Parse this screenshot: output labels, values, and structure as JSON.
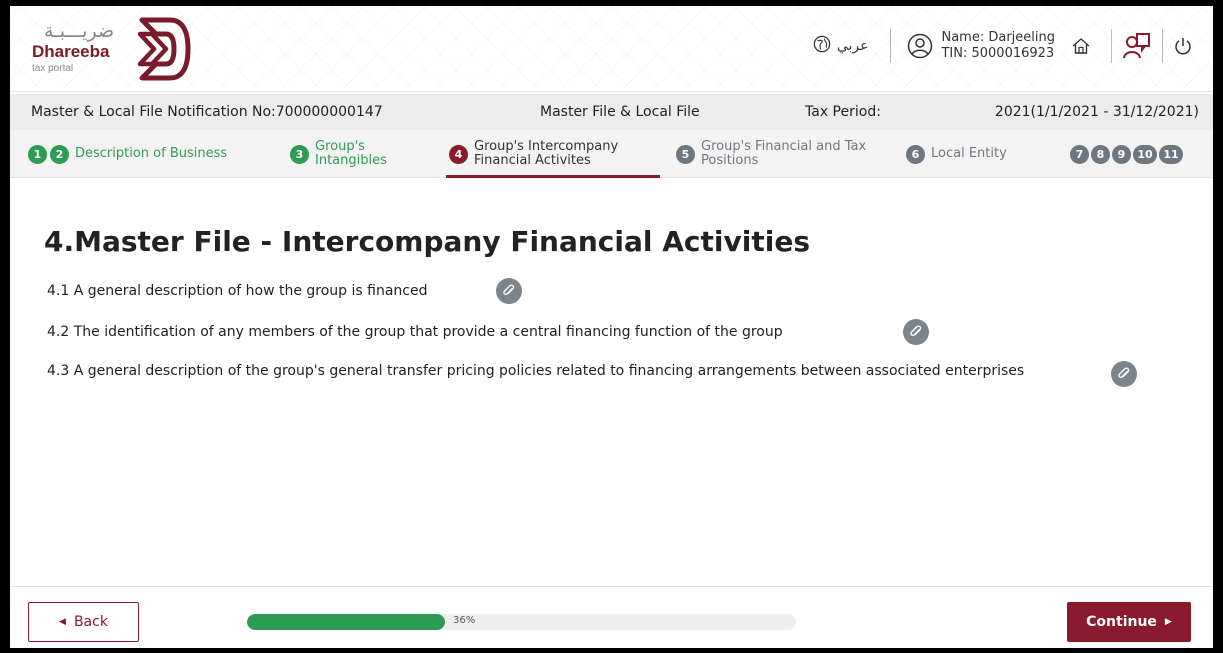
{
  "header": {
    "logo_arabic": "ضريـــبـة",
    "logo_name": "Dhareeba",
    "logo_sub": "tax portal",
    "language_label": "عربي",
    "user_name": "Name: Darjeeling",
    "user_tin": "TIN: 5000016923",
    "icons": [
      "globe-icon",
      "user-icon",
      "home-icon",
      "users-icon",
      "power-icon"
    ]
  },
  "infobar": {
    "notification": "Master & Local File Notification No:700000000147",
    "file_type": "Master File & Local File",
    "tax_period_label": "Tax Period:",
    "tax_period_value": "2021(1/1/2021 - 31/12/2021)"
  },
  "stepper": {
    "steps": [
      {
        "num": "1",
        "label": ""
      },
      {
        "num": "2",
        "label": "Description of Business"
      },
      {
        "num": "3",
        "label": "Group's Intangibles"
      },
      {
        "num": "4",
        "label": "Group's Intercompany Financial Activites"
      },
      {
        "num": "5",
        "label": "Group's Financial and Tax Positions"
      },
      {
        "num": "6",
        "label": "Local Entity"
      },
      {
        "num": "7",
        "label": ""
      },
      {
        "num": "8",
        "label": ""
      },
      {
        "num": "9",
        "label": ""
      },
      {
        "num": "10",
        "label": ""
      },
      {
        "num": "11",
        "label": ""
      }
    ]
  },
  "main": {
    "title": "4.Master File - Intercompany Financial Activities",
    "questions": [
      "4.1 A general description of how the group is financed",
      "4.2 The identification of any members of the group that provide a central financing function of the group",
      "4.3 A general description of the group's general transfer pricing policies related to financing arrangements between associated enterprises"
    ]
  },
  "footer": {
    "back_label": "Back",
    "continue_label": "Continue",
    "progress_text": "36%",
    "progress_fraction": 0.36
  },
  "colors": {
    "brand": "#8a1a2c",
    "green": "#2e9b53",
    "gray": "#6e7680"
  }
}
